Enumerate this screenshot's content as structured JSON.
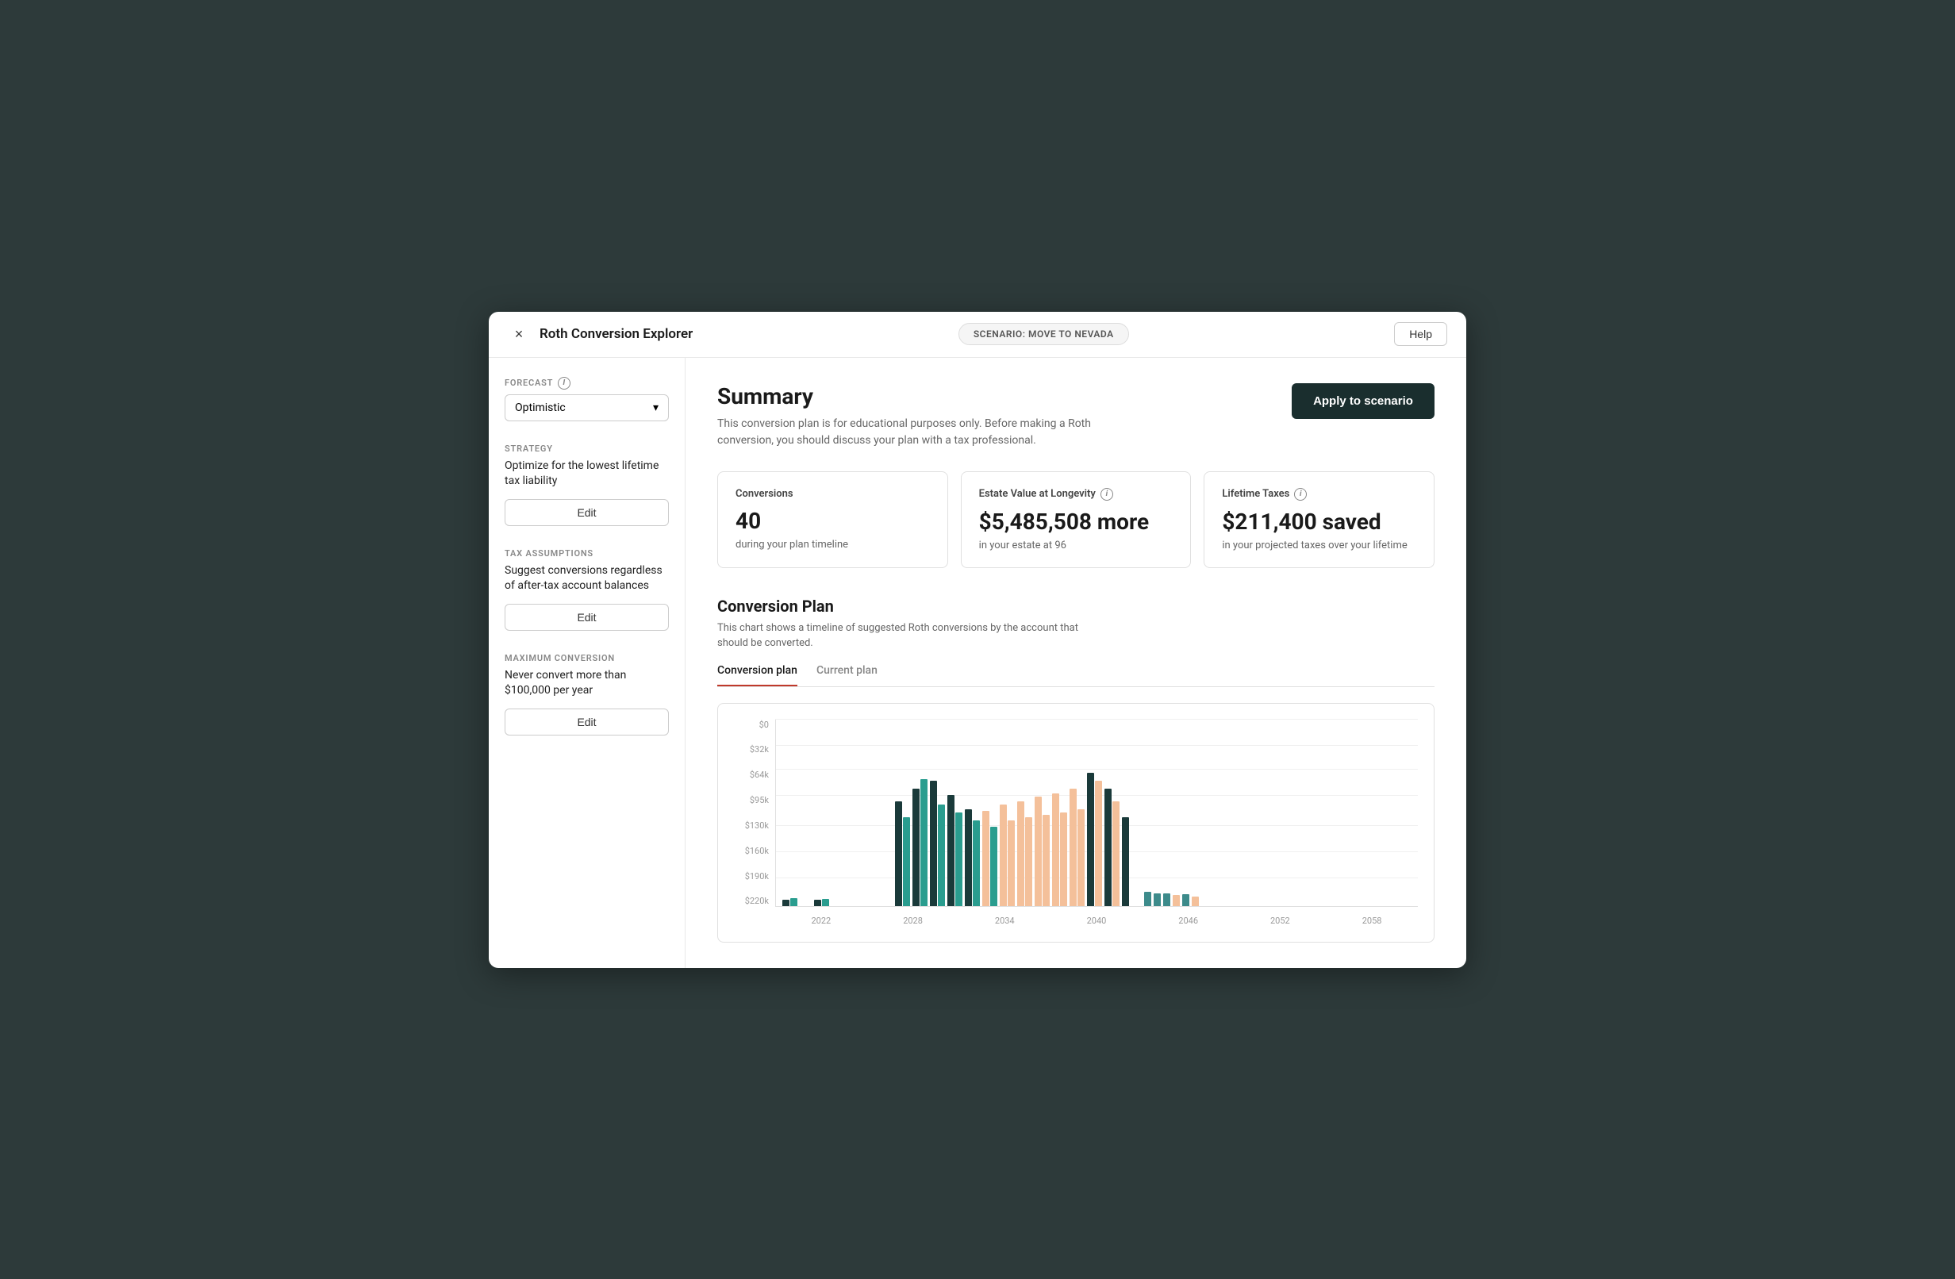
{
  "header": {
    "title": "Roth Conversion Explorer",
    "scenario_badge": "SCENARIO: MOVE TO NEVADA",
    "help_label": "Help",
    "close_icon": "×"
  },
  "sidebar": {
    "forecast_label": "FORECAST",
    "forecast_value": "Optimistic",
    "strategy_label": "STRATEGY",
    "strategy_value": "Optimize for the lowest lifetime tax liability",
    "strategy_edit": "Edit",
    "tax_label": "TAX ASSUMPTIONS",
    "tax_value": "Suggest conversions regardless of after-tax account balances",
    "tax_edit": "Edit",
    "max_label": "MAXIMUM CONVERSION",
    "max_value": "Never convert more than $100,000 per year",
    "max_edit": "Edit"
  },
  "summary": {
    "title": "Summary",
    "subtitle": "This conversion plan is for educational purposes only. Before making a Roth conversion, you should discuss your plan with a tax professional.",
    "apply_label": "Apply to scenario"
  },
  "metrics": [
    {
      "label": "Conversions",
      "value": "40",
      "sub": "during your plan timeline",
      "has_info": false
    },
    {
      "label": "Estate Value at Longevity",
      "value": "$5,485,508 more",
      "sub": "in your estate at 96",
      "has_info": true
    },
    {
      "label": "Lifetime Taxes",
      "value": "$211,400 saved",
      "sub": "in your projected taxes over your lifetime",
      "has_info": true
    }
  ],
  "conversion_plan": {
    "title": "Conversion Plan",
    "subtitle": "This chart shows a timeline of suggested Roth conversions by the account that should be converted.",
    "tabs": [
      "Conversion plan",
      "Current plan"
    ],
    "active_tab": 0
  },
  "chart": {
    "y_labels": [
      "$220k",
      "$190k",
      "$160k",
      "$130k",
      "$95k",
      "$64k",
      "$32k",
      "$0"
    ],
    "x_labels": [
      "2022",
      "2028",
      "2034",
      "2040",
      "2046",
      "2052",
      "2058"
    ],
    "bars": [
      {
        "year": "2022",
        "groups": [
          {
            "type": "dark-teal",
            "height": 8
          },
          {
            "type": "teal",
            "height": 10
          }
        ]
      },
      {
        "year": "2024",
        "groups": [
          {
            "type": "dark-teal",
            "height": 8
          },
          {
            "type": "teal",
            "height": 9
          }
        ]
      },
      {
        "year": "2040a",
        "groups": [
          {
            "type": "dark-teal",
            "height": 130
          },
          {
            "type": "teal",
            "height": 110
          }
        ]
      },
      {
        "year": "2040b",
        "groups": [
          {
            "type": "dark-teal",
            "height": 150
          },
          {
            "type": "teal",
            "height": 145
          }
        ]
      },
      {
        "year": "2041",
        "groups": [
          {
            "type": "dark-teal",
            "height": 160
          },
          {
            "type": "teal",
            "height": 125
          }
        ]
      },
      {
        "year": "2042",
        "groups": [
          {
            "type": "dark-teal",
            "height": 145
          },
          {
            "type": "teal",
            "height": 115
          }
        ]
      },
      {
        "year": "2043",
        "groups": [
          {
            "type": "dark-teal",
            "height": 125
          },
          {
            "type": "teal",
            "height": 105
          }
        ]
      },
      {
        "year": "2044",
        "groups": [
          {
            "type": "peach",
            "height": 118
          },
          {
            "type": "teal",
            "height": 100
          }
        ]
      },
      {
        "year": "2045",
        "groups": [
          {
            "type": "peach",
            "height": 128
          },
          {
            "type": "peach",
            "height": 105
          }
        ]
      },
      {
        "year": "2046",
        "groups": [
          {
            "type": "peach",
            "height": 130
          },
          {
            "type": "peach",
            "height": 108
          }
        ]
      },
      {
        "year": "2047",
        "groups": [
          {
            "type": "peach",
            "height": 135
          },
          {
            "type": "peach",
            "height": 110
          }
        ]
      },
      {
        "year": "2048",
        "groups": [
          {
            "type": "peach",
            "height": 138
          },
          {
            "type": "peach",
            "height": 112
          }
        ]
      },
      {
        "year": "2049",
        "groups": [
          {
            "type": "peach",
            "height": 142
          },
          {
            "type": "peach",
            "height": 118
          }
        ]
      },
      {
        "year": "2052a",
        "groups": [
          {
            "type": "dark-teal",
            "height": 165
          },
          {
            "type": "peach",
            "height": 155
          }
        ]
      },
      {
        "year": "2052b",
        "groups": [
          {
            "type": "dark-teal",
            "height": 148
          },
          {
            "type": "peach",
            "height": 130
          }
        ]
      },
      {
        "year": "2053",
        "groups": [
          {
            "type": "dark-teal",
            "height": 110
          }
        ]
      },
      {
        "year": "2056",
        "groups": [
          {
            "type": "light-teal",
            "height": 18
          }
        ]
      },
      {
        "year": "2057",
        "groups": [
          {
            "type": "light-teal",
            "height": 16
          }
        ]
      },
      {
        "year": "2058a",
        "groups": [
          {
            "type": "light-teal",
            "height": 16
          }
        ]
      },
      {
        "year": "2058b",
        "groups": [
          {
            "type": "peach",
            "height": 14
          }
        ]
      },
      {
        "year": "2059",
        "groups": [
          {
            "type": "light-teal",
            "height": 15
          }
        ]
      },
      {
        "year": "2060",
        "groups": [
          {
            "type": "peach",
            "height": 12
          }
        ]
      }
    ]
  }
}
